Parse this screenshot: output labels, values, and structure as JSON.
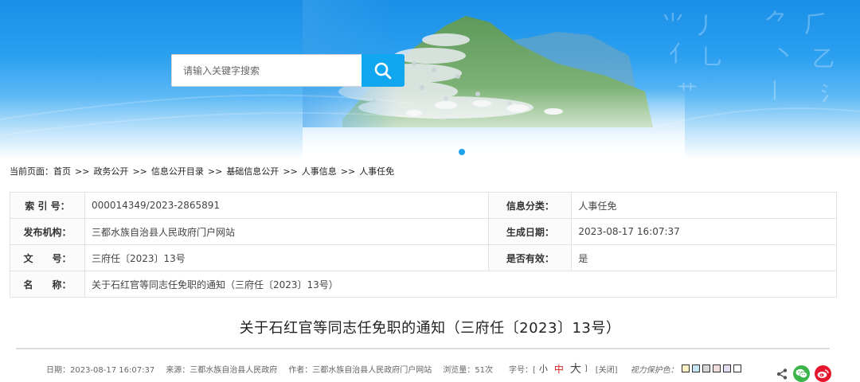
{
  "search": {
    "placeholder": "请输入关键字搜索"
  },
  "breadcrumb": {
    "prefix": "当前页面：",
    "separator": ">>",
    "items": [
      "首页",
      "政务公开",
      "信息公开目录",
      "基础信息公开",
      "人事信息",
      "人事任免"
    ]
  },
  "info": {
    "index_label": "索 引 号：",
    "index_value": "000014349/2023-2865891",
    "category_label": "信息分类：",
    "category_value": "人事任免",
    "publisher_label": "发布机构：",
    "publisher_value": "三都水族自治县人民政府门户网站",
    "created_label": "生成日期：",
    "created_value": "2023-08-17 16:07:37",
    "docno_label": "文　　号：",
    "docno_value": "三府任〔2023〕13号",
    "valid_label": "是否有效：",
    "valid_value": "是",
    "name_label": "名　　称：",
    "name_value": "关于石红官等同志任免职的通知（三府任〔2023〕13号）"
  },
  "article": {
    "title": "关于石红官等同志任免职的通知（三府任〔2023〕13号）"
  },
  "meta": {
    "date": "日期：2023-08-17 16:07:37",
    "source": "来源：三都水族自治县人民政府",
    "author": "作者：三都水族自治县人民政府门户网站",
    "views": "浏览量：51次",
    "font_label": "字号：[",
    "font_small": "小",
    "font_mid": "中",
    "font_big": "大",
    "font_end": "]",
    "close": "[关闭]",
    "eye_label": "视力保护色："
  },
  "swatch_colors": [
    "#fbf0c2",
    "#c7e6f3",
    "#d7d7d7",
    "#f1dede",
    "#e6dcf2",
    "#ffffff"
  ],
  "colors": {
    "accent": "#11a7f0",
    "font_mid": "#d6231e",
    "wechat": "#3bb54a",
    "weibo": "#e6162d"
  }
}
